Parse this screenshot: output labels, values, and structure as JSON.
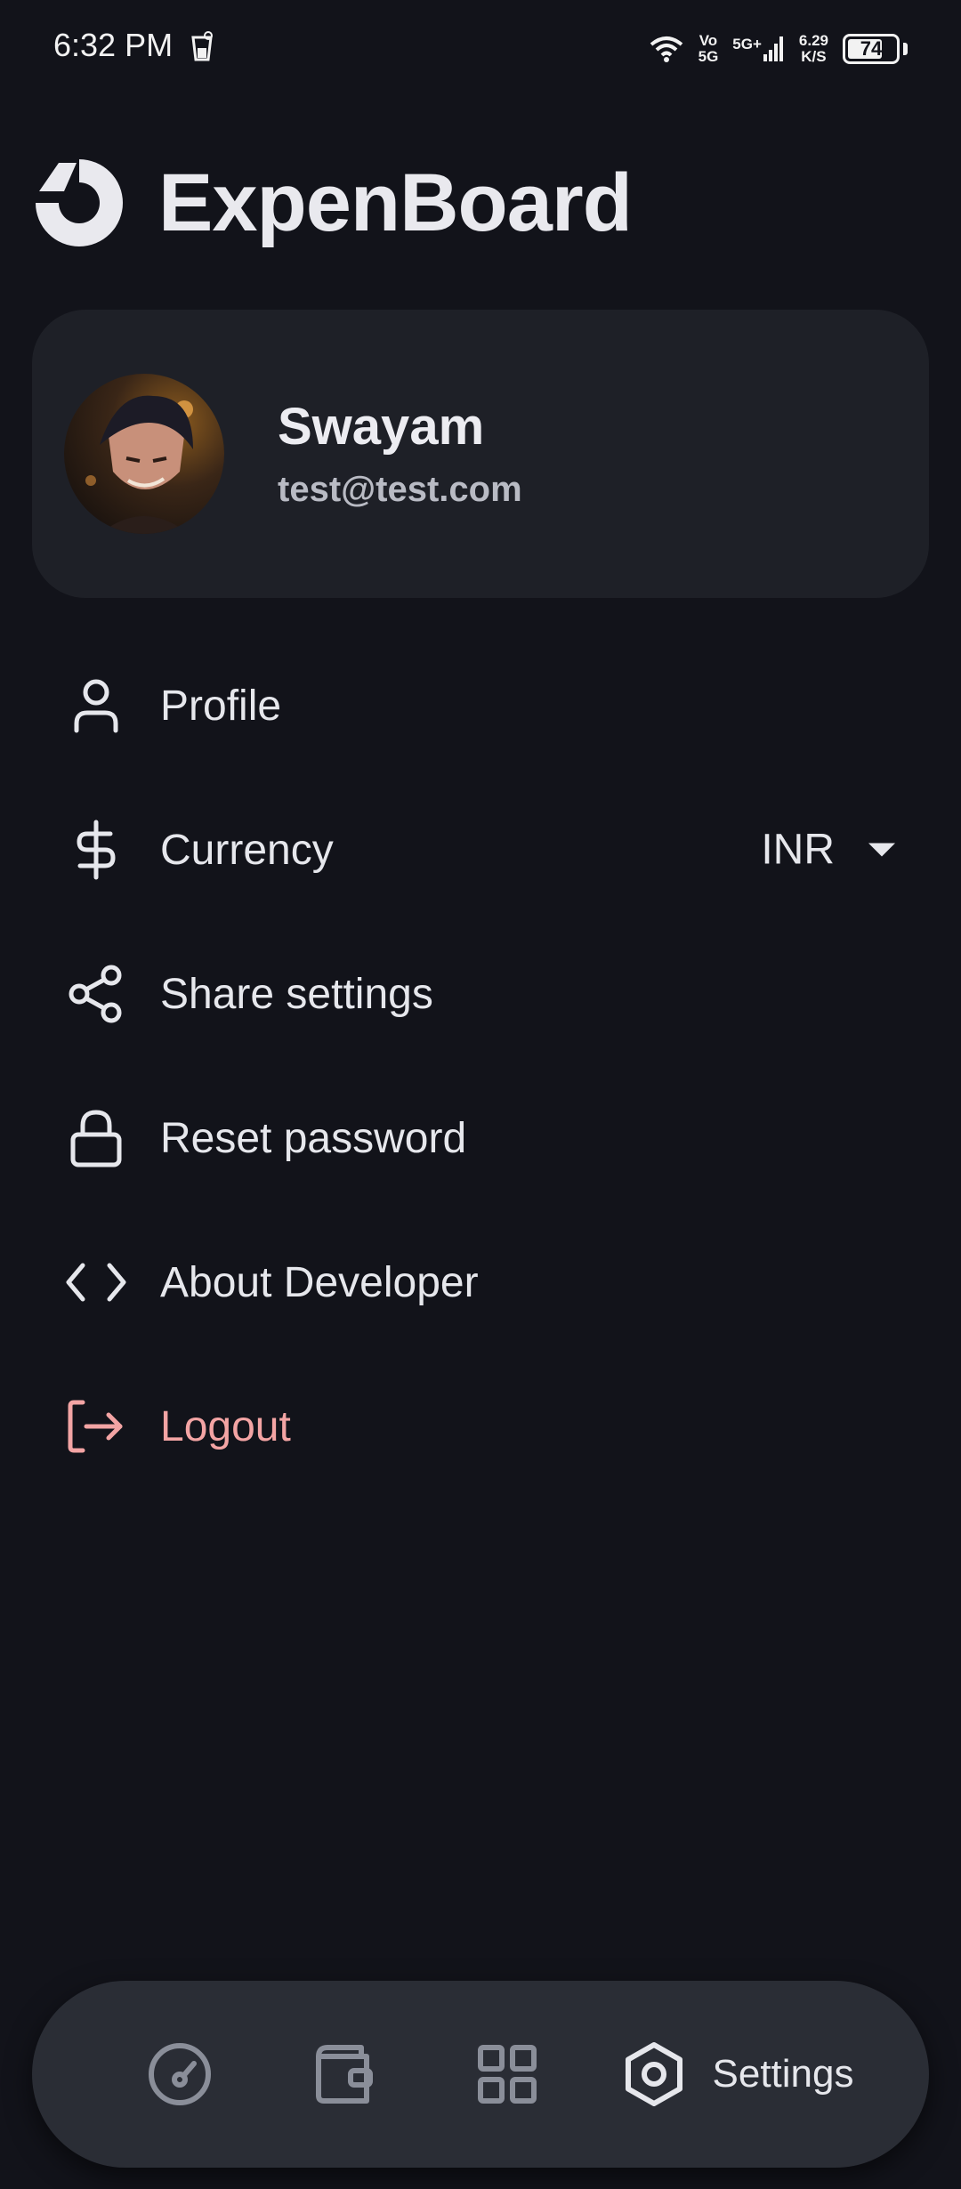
{
  "status_bar": {
    "time": "6:32 PM",
    "network_top": "Vo",
    "network_bottom": "5G",
    "signal_label": "5G+",
    "speed_value": "6.29",
    "speed_unit": "K/S",
    "battery_level": 74,
    "battery_text": "74"
  },
  "app": {
    "title": "ExpenBoard",
    "logo_icon": "expenboard-logo-icon"
  },
  "profile_card": {
    "name": "Swayam",
    "email": "test@test.com"
  },
  "menu": [
    {
      "label": "Profile",
      "icon": "user-icon"
    },
    {
      "label": "Currency",
      "icon": "dollar-icon"
    },
    {
      "label": "Share settings",
      "icon": "share-icon"
    },
    {
      "label": "Reset password",
      "icon": "lock-icon"
    },
    {
      "label": "About Developer",
      "icon": "code-icon"
    },
    {
      "label": "Logout",
      "icon": "logout-icon"
    }
  ],
  "currency": {
    "selected": "INR"
  },
  "bottom_nav": {
    "items": [
      {
        "icon": "dashboard-gauge-icon",
        "label": ""
      },
      {
        "icon": "wallet-icon",
        "label": ""
      },
      {
        "icon": "grid-icon",
        "label": ""
      },
      {
        "icon": "settings-hex-icon",
        "label": "Settings"
      }
    ],
    "active_index": 3
  },
  "colors": {
    "background": "#12131a",
    "card": "#1e2027",
    "nav_bar": "#2a2d35",
    "text_primary": "#e6e7ec",
    "text_secondary": "#b9bbc4",
    "danger": "#f3a4a4",
    "inactive_icon": "#8a8e99"
  }
}
